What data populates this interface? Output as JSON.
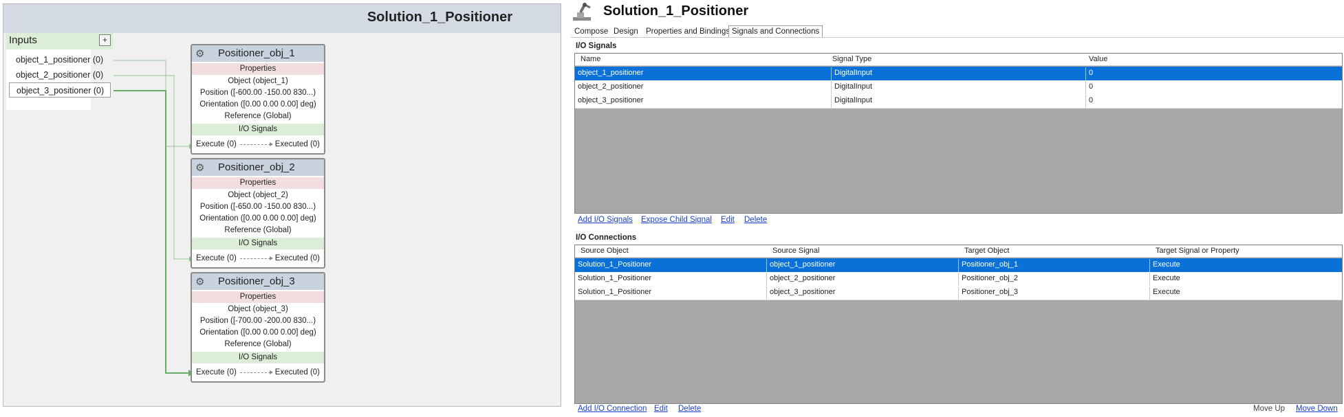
{
  "design": {
    "title": "Solution_1_Positioner",
    "inputs_label": "Inputs",
    "add_symbol": "+",
    "inputs": [
      {
        "label": "object_1_positioner (0)"
      },
      {
        "label": "object_2_positioner (0)"
      },
      {
        "label": "object_3_positioner (0)"
      }
    ],
    "blocks": [
      {
        "title": "Positioner_obj_1",
        "properties_label": "Properties",
        "object": "Object (object_1)",
        "position": "Position ([-600.00 -150.00 830...)",
        "orientation": "Orientation ([0.00 0.00 0.00] deg)",
        "reference": "Reference (Global)",
        "io_label": "I/O Signals",
        "execute": "Execute (0)",
        "executed": "Executed (0)"
      },
      {
        "title": "Positioner_obj_2",
        "properties_label": "Properties",
        "object": "Object (object_2)",
        "position": "Position ([-650.00 -150.00 830...)",
        "orientation": "Orientation ([0.00 0.00 0.00] deg)",
        "reference": "Reference (Global)",
        "io_label": "I/O Signals",
        "execute": "Execute (0)",
        "executed": "Executed (0)"
      },
      {
        "title": "Positioner_obj_3",
        "properties_label": "Properties",
        "object": "Object (object_3)",
        "position": "Position ([-700.00 -200.00 830...)",
        "orientation": "Orientation ([0.00 0.00 0.00] deg)",
        "reference": "Reference (Global)",
        "io_label": "I/O Signals",
        "execute": "Execute (0)",
        "executed": "Executed (0)"
      }
    ],
    "icon": "positioner-icon",
    "wire_color": "#8fbe8a",
    "active_wire_color": "#6aab62"
  },
  "editor": {
    "title": "Solution_1_Positioner",
    "icon": "smart-component-icon",
    "tabs": [
      "Compose",
      "Design",
      "Properties and Bindings",
      "Signals and Connections"
    ],
    "active_tab": "Signals and Connections",
    "io_signals": {
      "title": "I/O Signals",
      "columns": [
        "Name",
        "Signal Type",
        "Value"
      ],
      "rows": [
        [
          "object_1_positioner",
          "DigitalInput",
          "0"
        ],
        [
          "object_2_positioner",
          "DigitalInput",
          "0"
        ],
        [
          "object_3_positioner",
          "DigitalInput",
          "0"
        ]
      ],
      "selected_row": 0,
      "actions": [
        "Add I/O Signals",
        "Expose Child Signal",
        "Edit",
        "Delete"
      ]
    },
    "io_connections": {
      "title": "I/O Connections",
      "columns": [
        "Source Object",
        "Source Signal",
        "Target Object",
        "Target Signal or Property"
      ],
      "rows": [
        [
          "Solution_1_Positioner",
          "object_1_positioner",
          "Positioner_obj_1",
          "Execute"
        ],
        [
          "Solution_1_Positioner",
          "object_2_positioner",
          "Positioner_obj_2",
          "Execute"
        ],
        [
          "Solution_1_Positioner",
          "object_3_positioner",
          "Positioner_obj_3",
          "Execute"
        ]
      ],
      "selected_row": 0,
      "actions": [
        "Add I/O Connection",
        "Edit",
        "Delete"
      ],
      "move_up": "Move Up",
      "move_down": "Move Down"
    },
    "selection_color": "#0a71d8",
    "link_color": "#1a3fcc"
  }
}
